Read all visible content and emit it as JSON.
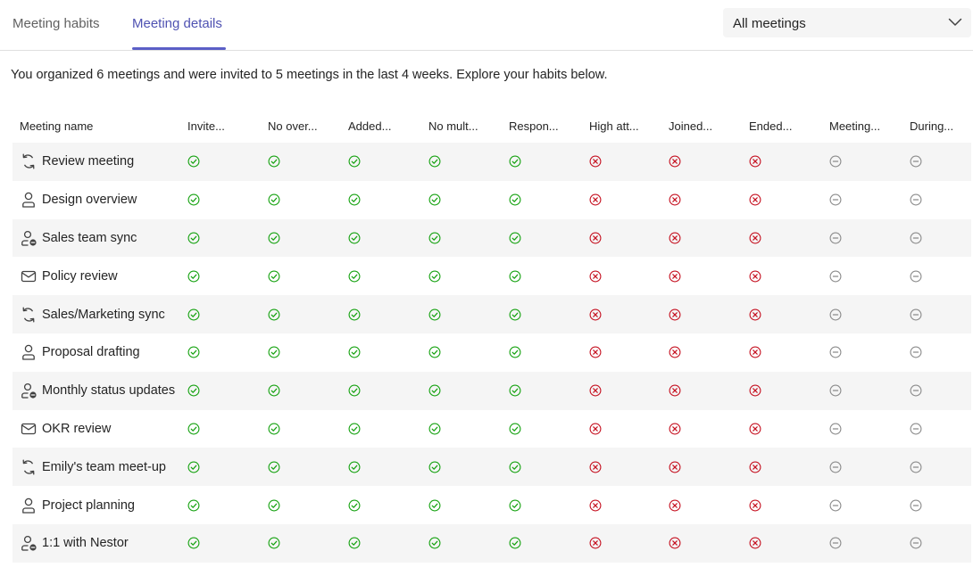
{
  "tabs": [
    {
      "label": "Meeting habits",
      "active": false
    },
    {
      "label": "Meeting details",
      "active": true
    }
  ],
  "filter": {
    "value": "All meetings",
    "icon": "chevron-down-icon"
  },
  "summary": "You organized 6 meetings and were invited to 5 meetings in the last 4 weeks. Explore your habits below.",
  "colors": {
    "accent": "#5b5fc7",
    "pass": "#13a10e",
    "fail": "#c50f1f",
    "neutral": "#8a8a8a",
    "row_alt": "#f5f5f5"
  },
  "table": {
    "headers": [
      "Meeting name",
      "Invite...",
      "No over...",
      "Added...",
      "No mult...",
      "Respon...",
      "High att...",
      "Joined...",
      "Ended...",
      "Meeting...",
      "During..."
    ],
    "status_pattern": [
      "check",
      "check",
      "check",
      "check",
      "check",
      "cross",
      "cross",
      "cross",
      "neutral",
      "neutral"
    ],
    "rows": [
      {
        "name": "Review meeting",
        "icon": "recurring-icon"
      },
      {
        "name": "Design overview",
        "icon": "person-icon"
      },
      {
        "name": "Sales team sync",
        "icon": "person-blocked-icon"
      },
      {
        "name": "Policy review",
        "icon": "mail-icon"
      },
      {
        "name": "Sales/Marketing sync",
        "icon": "recurring-icon"
      },
      {
        "name": "Proposal drafting",
        "icon": "person-icon"
      },
      {
        "name": "Monthly status updates",
        "icon": "person-blocked-icon"
      },
      {
        "name": "OKR review",
        "icon": "mail-icon"
      },
      {
        "name": "Emily's team meet-up",
        "icon": "recurring-icon"
      },
      {
        "name": "Project planning",
        "icon": "person-icon"
      },
      {
        "name": "1:1 with Nestor",
        "icon": "person-blocked-icon"
      }
    ]
  }
}
